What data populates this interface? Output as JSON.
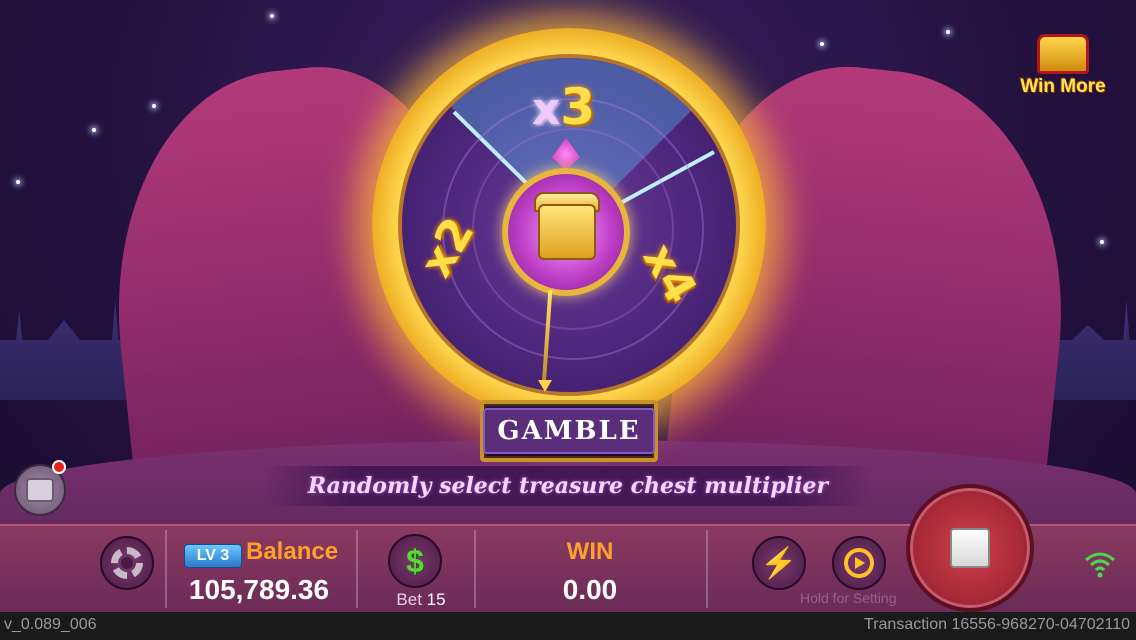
{
  "overlay": {
    "win_more_label": "Win More"
  },
  "wheel": {
    "multipliers": {
      "top": {
        "prefix": "x",
        "value": "3"
      },
      "left": "x2",
      "right": "x4"
    }
  },
  "gamble": {
    "button_label": "GAMBLE",
    "tagline": "Randomly select treasure chest multiplier"
  },
  "bottom_bar": {
    "level_badge": "LV 3",
    "balance_label": "Balance",
    "balance_value": "105,789.36",
    "bet_label": "Bet",
    "bet_value": "15",
    "win_label": "WIN",
    "win_value": "0.00",
    "hold_hint": "Hold for Setting"
  },
  "status": {
    "version": "v_0.089_006",
    "transaction": "Transaction 16556-968270-04702110"
  },
  "icons": {
    "settings": "gear-icon",
    "bet": "dollar-icon",
    "turbo": "lightning-icon",
    "autoplay": "autoplay-icon",
    "spin": "stop-icon",
    "connection": "wifi-icon",
    "bag": "backpack-icon",
    "win_more": "treasure-chest-icon"
  },
  "colors": {
    "accent_orange": "#ffa12a",
    "gold": "#ffe04a",
    "bet_green": "#5ad83a",
    "spin_red": "#a82a38",
    "bar_purple": "#6a2a58"
  }
}
